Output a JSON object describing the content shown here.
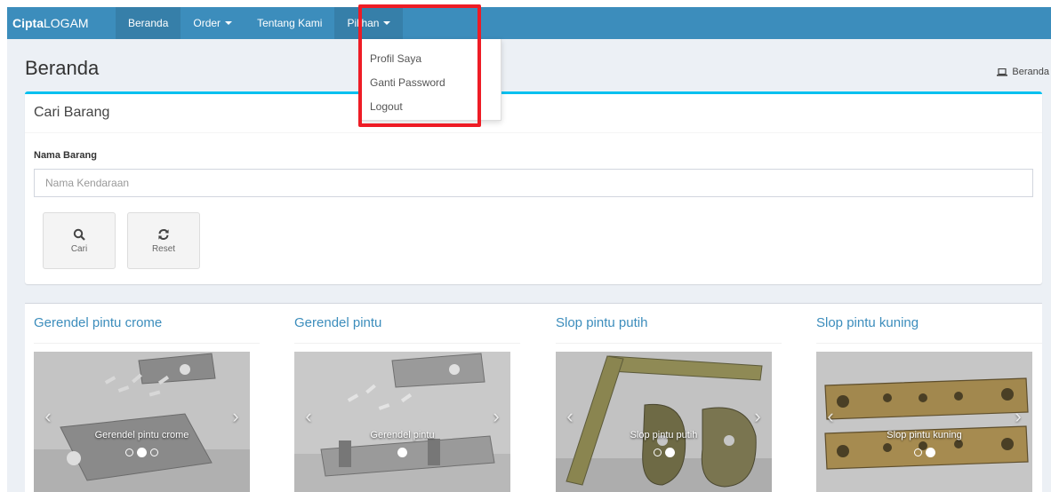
{
  "navbar": {
    "brand_bold": "Cipta",
    "brand_rest": "LOGAM",
    "items": [
      {
        "label": "Beranda"
      },
      {
        "label": "Order"
      },
      {
        "label": "Tentang Kami"
      },
      {
        "label": "Pilihan"
      }
    ]
  },
  "dropdown": {
    "items": [
      "Profil Saya",
      "Ganti Password",
      "Logout"
    ]
  },
  "page": {
    "title": "Beranda",
    "breadcrumb": "Beranda"
  },
  "search_box": {
    "title": "Cari Barang",
    "field_label": "Nama Barang",
    "placeholder": "Nama Kendaraan",
    "search_label": "Cari",
    "reset_label": "Reset"
  },
  "products": [
    {
      "title": "Gerendel pintu crome",
      "caption": "Gerendel pintu crome",
      "slides": 3,
      "active": 1
    },
    {
      "title": "Gerendel pintu",
      "caption": "Gerendel pintu",
      "slides": 1,
      "active": 0
    },
    {
      "title": "Slop pintu putih",
      "caption": "Slop pintu putih",
      "slides": 2,
      "active": 1
    },
    {
      "title": "Slop pintu kuning",
      "caption": "Slop pintu kuning",
      "slides": 2,
      "active": 1
    }
  ],
  "colors": {
    "navbar": "#3c8dbc",
    "box_accent": "#00c0ef",
    "highlight": "#ee1c25",
    "product_title": "#3c8dbc"
  },
  "icons": {
    "breadcrumb": "laptop-icon",
    "search": "search-icon",
    "reset": "refresh-icon"
  }
}
